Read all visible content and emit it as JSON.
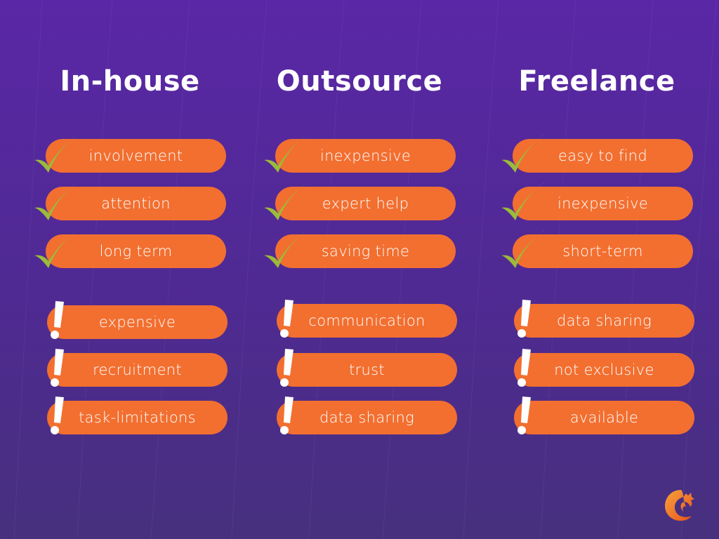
{
  "colors": {
    "background": "#5a27a6",
    "pill": "#f26f30",
    "check": "#9bbb3a",
    "text": "#ffffff"
  },
  "columns": [
    {
      "title": "In-house",
      "pros": [
        "involvement",
        "attention",
        "long term"
      ],
      "cons": [
        "expensive",
        "recruitment",
        "task-limitations"
      ]
    },
    {
      "title": "Outsource",
      "pros": [
        "inexpensive",
        "expert help",
        "saving time"
      ],
      "cons": [
        "communication",
        "trust",
        "data sharing"
      ]
    },
    {
      "title": "Freelance",
      "pros": [
        "easy to find",
        "inexpensive",
        "short-term"
      ],
      "cons": [
        "data sharing",
        "not exclusive",
        "available"
      ]
    }
  ],
  "icons": {
    "pro": "checkmark-icon",
    "con": "exclamation-icon",
    "logo": "phoenix-logo-icon"
  }
}
